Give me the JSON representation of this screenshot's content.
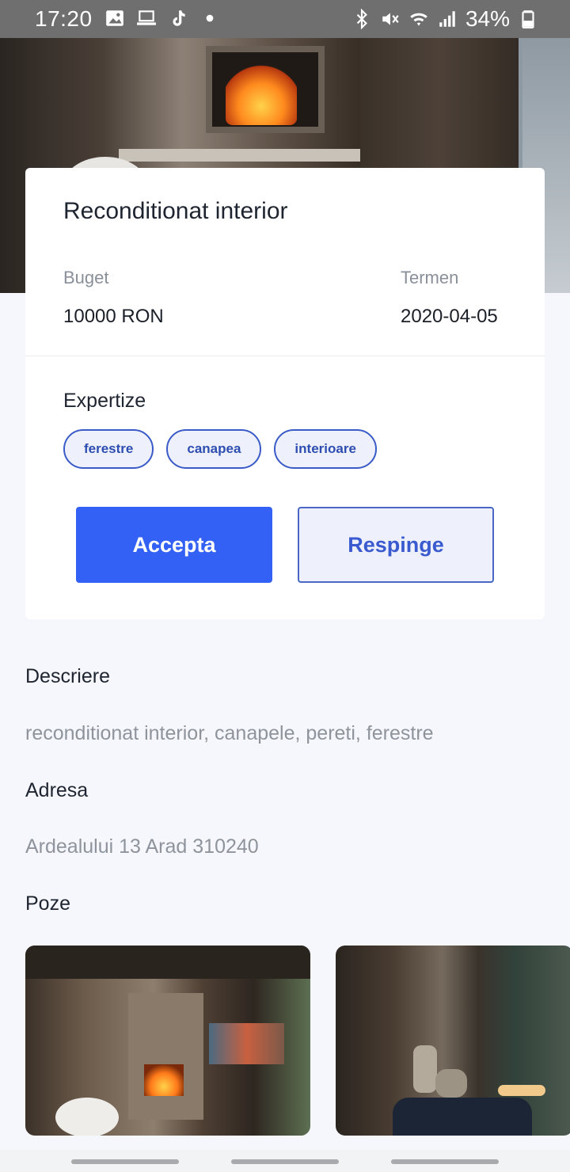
{
  "status_bar": {
    "time": "17:20",
    "battery": "34%",
    "icons": [
      "image-icon",
      "laptop-icon",
      "tiktok-icon",
      "dot-icon",
      "bluetooth-icon",
      "mute-icon",
      "wifi-icon",
      "signal-icon",
      "battery-icon"
    ]
  },
  "job": {
    "title": "Reconditionat interior",
    "budget_label": "Buget",
    "budget_value": "10000 RON",
    "deadline_label": "Termen",
    "deadline_value": "2020-04-05",
    "expertise_title": "Expertize",
    "tags": [
      "ferestre",
      "canapea",
      "interioare"
    ],
    "accept_label": "Accepta",
    "reject_label": "Respinge"
  },
  "details": {
    "description_title": "Descriere",
    "description_text": "reconditionat interior, canapele, pereti, ferestre",
    "address_title": "Adresa",
    "address_text": "Ardealului 13 Arad 310240",
    "photos_title": "Poze"
  },
  "colors": {
    "accent": "#3461f5",
    "chip_border": "#3a5bc7",
    "background": "#f5f7fc"
  }
}
